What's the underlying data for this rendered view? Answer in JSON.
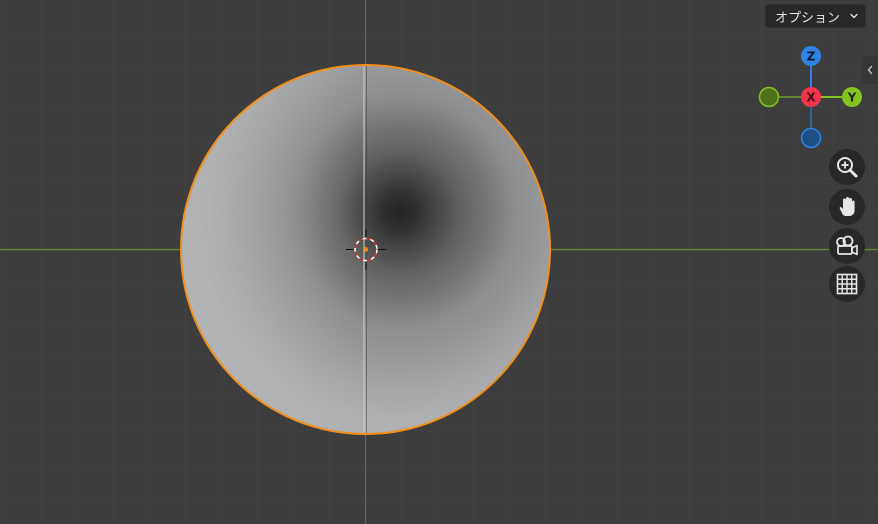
{
  "header": {
    "options_label": "オプション"
  },
  "gizmo": {
    "z_label": "Z",
    "x_label": "X",
    "y_label": "Y",
    "colors": {
      "x": "#f5344c",
      "y": "#84c322",
      "z": "#2f84e3",
      "neg_y": "#5a7a1e",
      "neg_z": "#1f5490"
    }
  },
  "navigation": {
    "zoom_icon": "zoom-in-icon",
    "pan_icon": "hand-icon",
    "camera_icon": "camera-view-icon",
    "ortho_icon": "grid-perspective-icon"
  },
  "scene": {
    "selected_outline_color": "#f08f1c",
    "grid_color": "#444444",
    "x_axis_color": "#62872e",
    "z_axis_color": "#5b7394"
  }
}
